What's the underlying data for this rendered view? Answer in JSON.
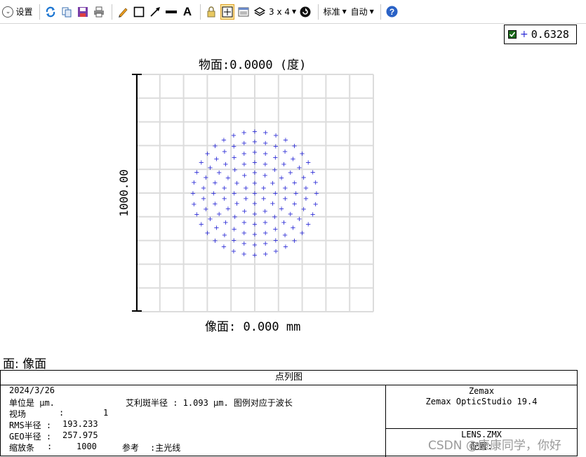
{
  "toolbar": {
    "settings_label": "设置",
    "layout_label": "3 x 4",
    "standard_label": "标准",
    "auto_label": "自动",
    "text_tool_glyph": "A"
  },
  "legend": {
    "value": "0.6328",
    "symbol": "+"
  },
  "plot": {
    "title": "物面:0.0000 (度)",
    "xlabel": "像面: 0.000 mm",
    "scale_label": "1000.00",
    "marker": "+",
    "marker_color": "#2b2bd6",
    "grid_color": "#dcdcdc"
  },
  "surface_label": "面: 像面",
  "info": {
    "heading": "点列图",
    "date": "2024/3/26",
    "units": "单位是 μm.",
    "airy": "艾利斑半径 : 1.093 μm. 图例对应于波长",
    "field_label": "视场",
    "field_sep": ":",
    "field_value": "1",
    "rms_label": "RMS半径 :",
    "rms_value": "193.233",
    "geo_label": "GEO半径 :",
    "geo_value": "257.975",
    "scale_label": "缩放条",
    "scale_sep": ":",
    "scale_value": "1000",
    "ref_label": "参考",
    "ref_value": ":主光线",
    "company": "Zemax",
    "product": "Zemax OpticStudio 19.4",
    "lens_file": "LENS.ZMX",
    "config": "配置:"
  },
  "watermark": "CSDN @康康同学，你好"
}
